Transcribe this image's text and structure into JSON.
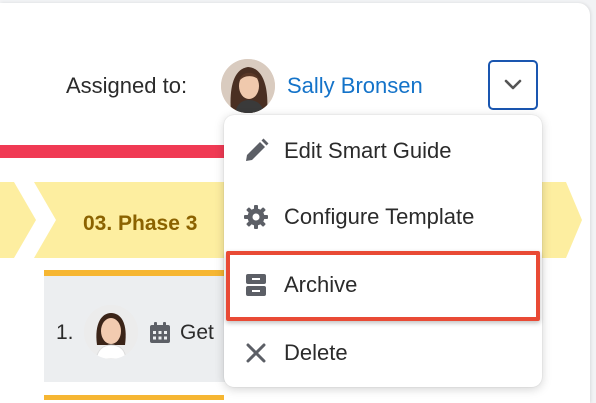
{
  "header": {
    "assigned_label": "Assigned to:",
    "assignee_name": "Sally Bronsen"
  },
  "phase": {
    "label": "03. Phase 3"
  },
  "task": {
    "number": "1.",
    "text_prefix": "Get"
  },
  "menu": {
    "items": [
      {
        "label": "Edit Smart Guide",
        "icon": "pencil-icon"
      },
      {
        "label": "Configure Template",
        "icon": "gear-icon"
      },
      {
        "label": "Archive",
        "icon": "archive-icon",
        "highlighted": true
      },
      {
        "label": "Delete",
        "icon": "close-icon"
      }
    ]
  },
  "colors": {
    "link": "#1473c9",
    "accent_border": "#1a56b0",
    "progress": "#f03a54",
    "phase_fill": "#fdeea0",
    "phase_text": "#8b6200",
    "task_bar": "#f6b632",
    "highlight": "#e94a35"
  }
}
